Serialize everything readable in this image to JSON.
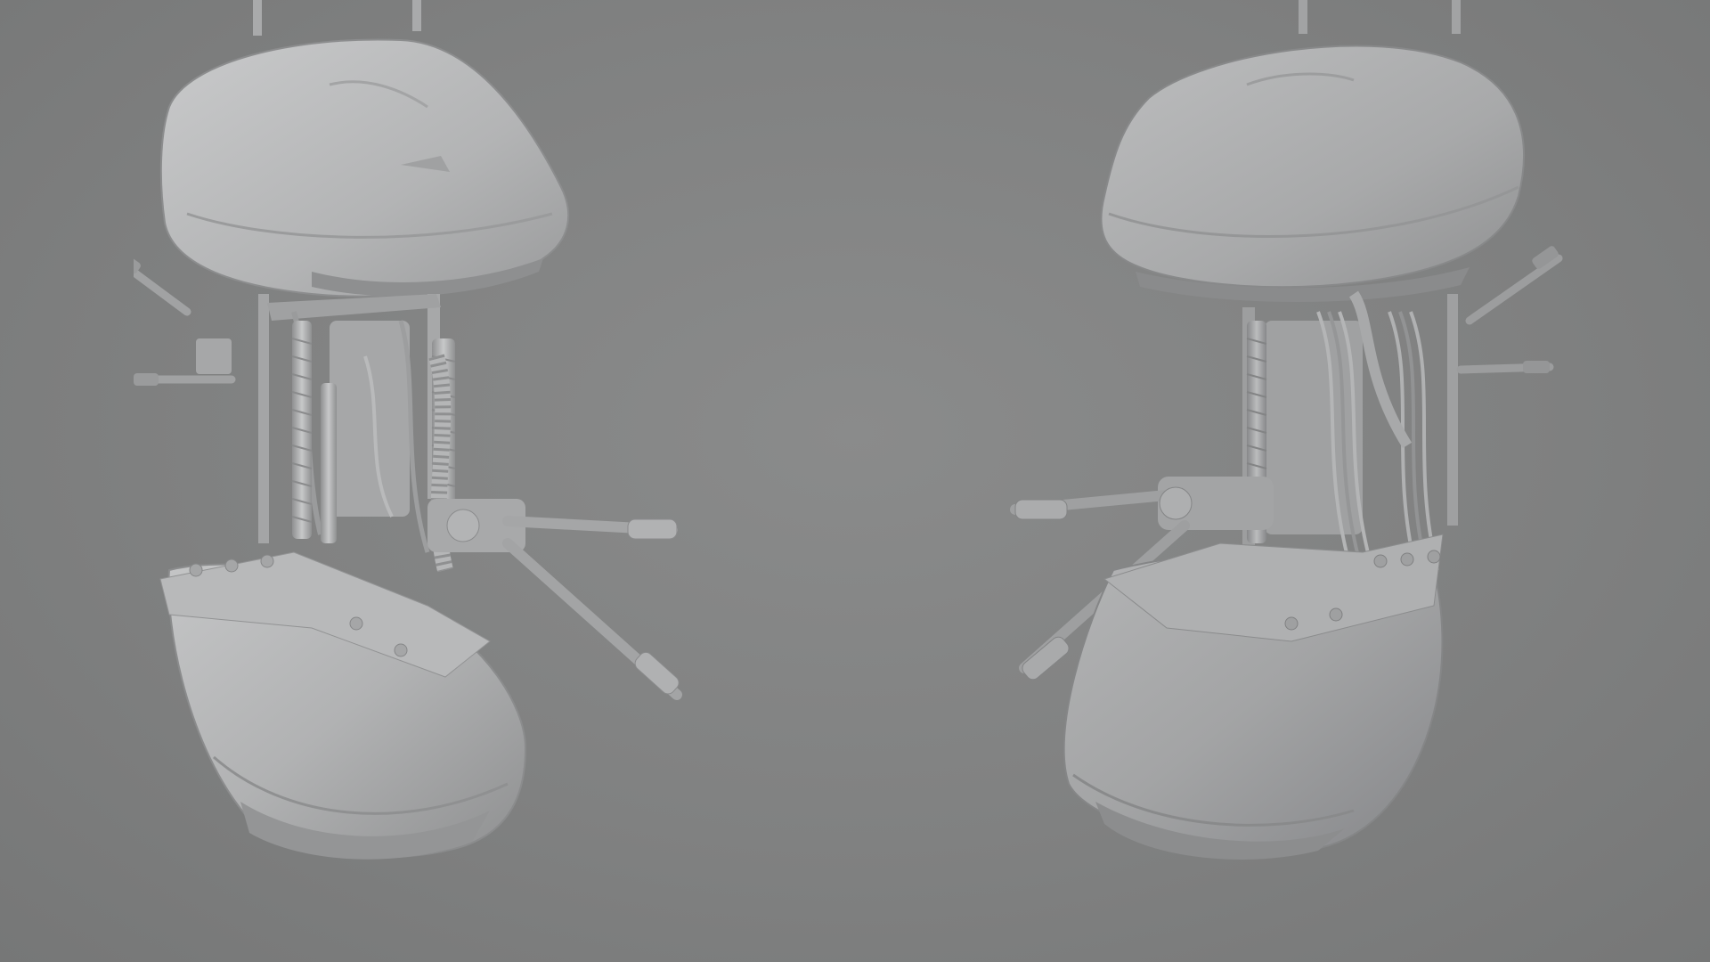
{
  "scene": {
    "background": "#808181",
    "models": [
      {
        "name": "turret-render-left",
        "shade_base": "#b4b5b6",
        "shade_dark": "#8d8e8f",
        "shade_light": "#d2d3d4"
      },
      {
        "name": "turret-render-right",
        "shade_base": "#a9aaab",
        "shade_dark": "#858687",
        "shade_light": "#c6c7c8"
      }
    ]
  }
}
